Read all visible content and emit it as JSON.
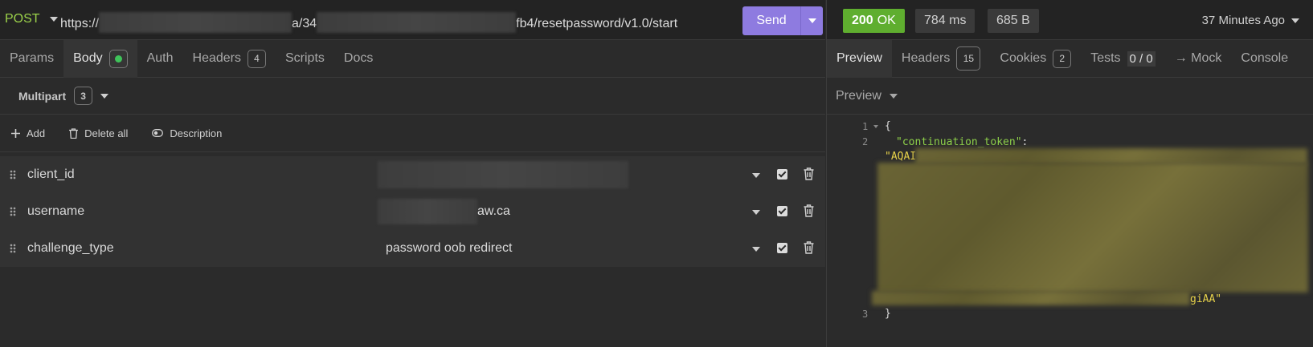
{
  "request": {
    "method": "POST",
    "url_prefix": "https://",
    "url_mid": "a/34",
    "url_suffix": "fb4/resetpassword/v1.0/start",
    "send_label": "Send"
  },
  "request_tabs": [
    {
      "label": "Params"
    },
    {
      "label": "Body"
    },
    {
      "label": "Auth"
    },
    {
      "label": "Headers",
      "count": "4"
    },
    {
      "label": "Scripts"
    },
    {
      "label": "Docs"
    }
  ],
  "body": {
    "mode_label": "Multipart",
    "mode_count": "3",
    "actions": {
      "add": "Add",
      "delete_all": "Delete all",
      "description": "Description"
    },
    "params": [
      {
        "name": "client_id",
        "value": ""
      },
      {
        "name": "username",
        "value": "aw.ca"
      },
      {
        "name": "challenge_type",
        "value": "password oob redirect"
      }
    ]
  },
  "response": {
    "status_code": "200",
    "status_text": "OK",
    "time": "784 ms",
    "size": "685 B",
    "ago": "37 Minutes Ago",
    "tabs": {
      "preview": "Preview",
      "headers": "Headers",
      "headers_count": "15",
      "cookies": "Cookies",
      "cookies_count": "2",
      "tests": "Tests",
      "tests_count": "0 / 0",
      "mock": "→ Mock",
      "console": "Console"
    },
    "preview_label": "Preview",
    "code": {
      "line1": "1",
      "line2": "2",
      "line3": "3",
      "open": "{",
      "key": "\"continuation_token\"",
      "colon": ":",
      "value_start": "\"AQAI",
      "value_end": "giAA\"",
      "close": "}"
    }
  },
  "colors": {
    "method": "#9bd14a",
    "send": "#8e7be0",
    "status_ok": "#5fae2f",
    "json_key": "#8ed14a",
    "json_string": "#e8d34a"
  }
}
